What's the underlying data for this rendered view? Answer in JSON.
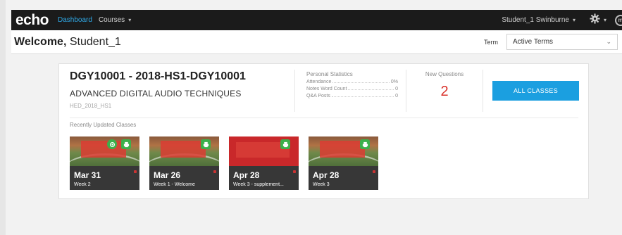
{
  "topbar": {
    "logo": "echo",
    "nav_dashboard": "Dashboard",
    "nav_courses": "Courses",
    "user_name": "Student_1 Swinburne",
    "caret": "▾",
    "brand_initial": "m"
  },
  "header": {
    "welcome_prefix": "Welcome,",
    "welcome_name": " Student_1",
    "term_label": "Term",
    "term_value": "Active Terms",
    "term_chevron": "⌄"
  },
  "course": {
    "code": "DGY10001 - 2018-HS1-DGY10001",
    "title": "ADVANCED DIGITAL AUDIO TECHNIQUES",
    "term": "HED_2018_HS1",
    "stats_title": "Personal Statistics",
    "stats": [
      {
        "label": "Attendance",
        "value": "0%"
      },
      {
        "label": "Notes Word Count",
        "value": "0"
      },
      {
        "label": "Q&A Posts",
        "value": "0"
      }
    ],
    "new_questions_title": "New Questions",
    "new_questions_count": "2",
    "all_classes_label": "ALL CLASSES",
    "recent_label": "Recently Updated Classes"
  },
  "classes": [
    {
      "date": "Mar 31",
      "subtitle": "Week 2",
      "thumb": "stadium",
      "icons": [
        "live-circle",
        "print"
      ]
    },
    {
      "date": "Mar 26",
      "subtitle": "Week 1 - Welcome",
      "thumb": "stadium",
      "icons": [
        "print"
      ]
    },
    {
      "date": "Apr 28",
      "subtitle": "Week 3 - supplement...",
      "thumb": "slide-red",
      "icons": [
        "print"
      ]
    },
    {
      "date": "Apr 28",
      "subtitle": "Week 3",
      "thumb": "stadium",
      "icons": [
        "print"
      ]
    }
  ],
  "colors": {
    "accent": "#1b9fe0",
    "nav_active": "#2fa8e6",
    "topbar": "#1b1b1b",
    "new_questions": "#d9322b",
    "badge": "#3cb04b"
  }
}
